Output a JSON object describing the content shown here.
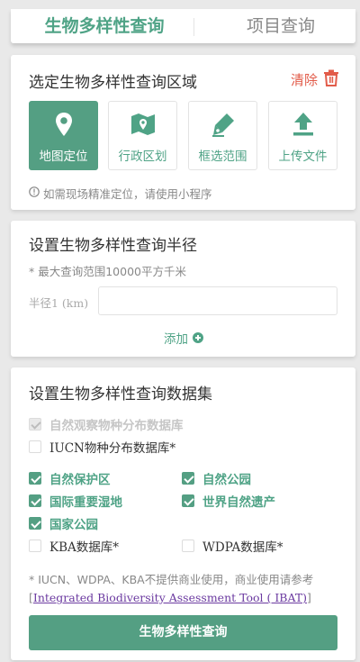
{
  "tabs": [
    {
      "label": "生物多样性查询",
      "active": true
    },
    {
      "label": "项目查询",
      "active": false
    }
  ],
  "region": {
    "title": "选定生物多样性查询区域",
    "clear_label": "清除",
    "options": [
      {
        "label": "地图定位",
        "icon": "location-pin-icon",
        "active": true
      },
      {
        "label": "行政区划",
        "icon": "map-icon",
        "active": false
      },
      {
        "label": "框选范围",
        "icon": "pen-draw-icon",
        "active": false
      },
      {
        "label": "上传文件",
        "icon": "upload-icon",
        "active": false
      }
    ],
    "hint": "如需现场精准定位，请使用小程序"
  },
  "radius": {
    "title": "设置生物多样性查询半径",
    "note": "* 最大查询范围10000平方千米",
    "field_label": "半径1 (km)",
    "field_value": "",
    "add_label": "添加"
  },
  "dataset": {
    "title": "设置生物多样性查询数据集",
    "items": [
      {
        "label": "自然观察物种分布数据库",
        "checked": true,
        "disabled": true
      },
      {
        "label": "IUCN物种分布数据库*",
        "checked": false,
        "disabled": false
      },
      {
        "label": "自然保护区",
        "checked": true,
        "disabled": false
      },
      {
        "label": "自然公园",
        "checked": true,
        "disabled": false
      },
      {
        "label": "国际重要湿地",
        "checked": true,
        "disabled": false
      },
      {
        "label": "世界自然遗产",
        "checked": true,
        "disabled": false
      },
      {
        "label": "国家公园",
        "checked": true,
        "disabled": false
      },
      {
        "label": "KBA数据库*",
        "checked": false,
        "disabled": false
      },
      {
        "label": "WDPA数据库*",
        "checked": false,
        "disabled": false
      }
    ],
    "footnote_prefix": "* IUCN、WDPA、KBA不提供商业使用，商业使用请参考[",
    "footnote_link": "Integrated Biodiversity Assessment Tool ( IBAT)",
    "footnote_suffix": "]",
    "submit_label": "生物多样性查询"
  },
  "colors": {
    "accent": "#549f83",
    "accent_text": "#4fa386",
    "danger": "#e25c4a",
    "background": "#e9e9e9"
  }
}
